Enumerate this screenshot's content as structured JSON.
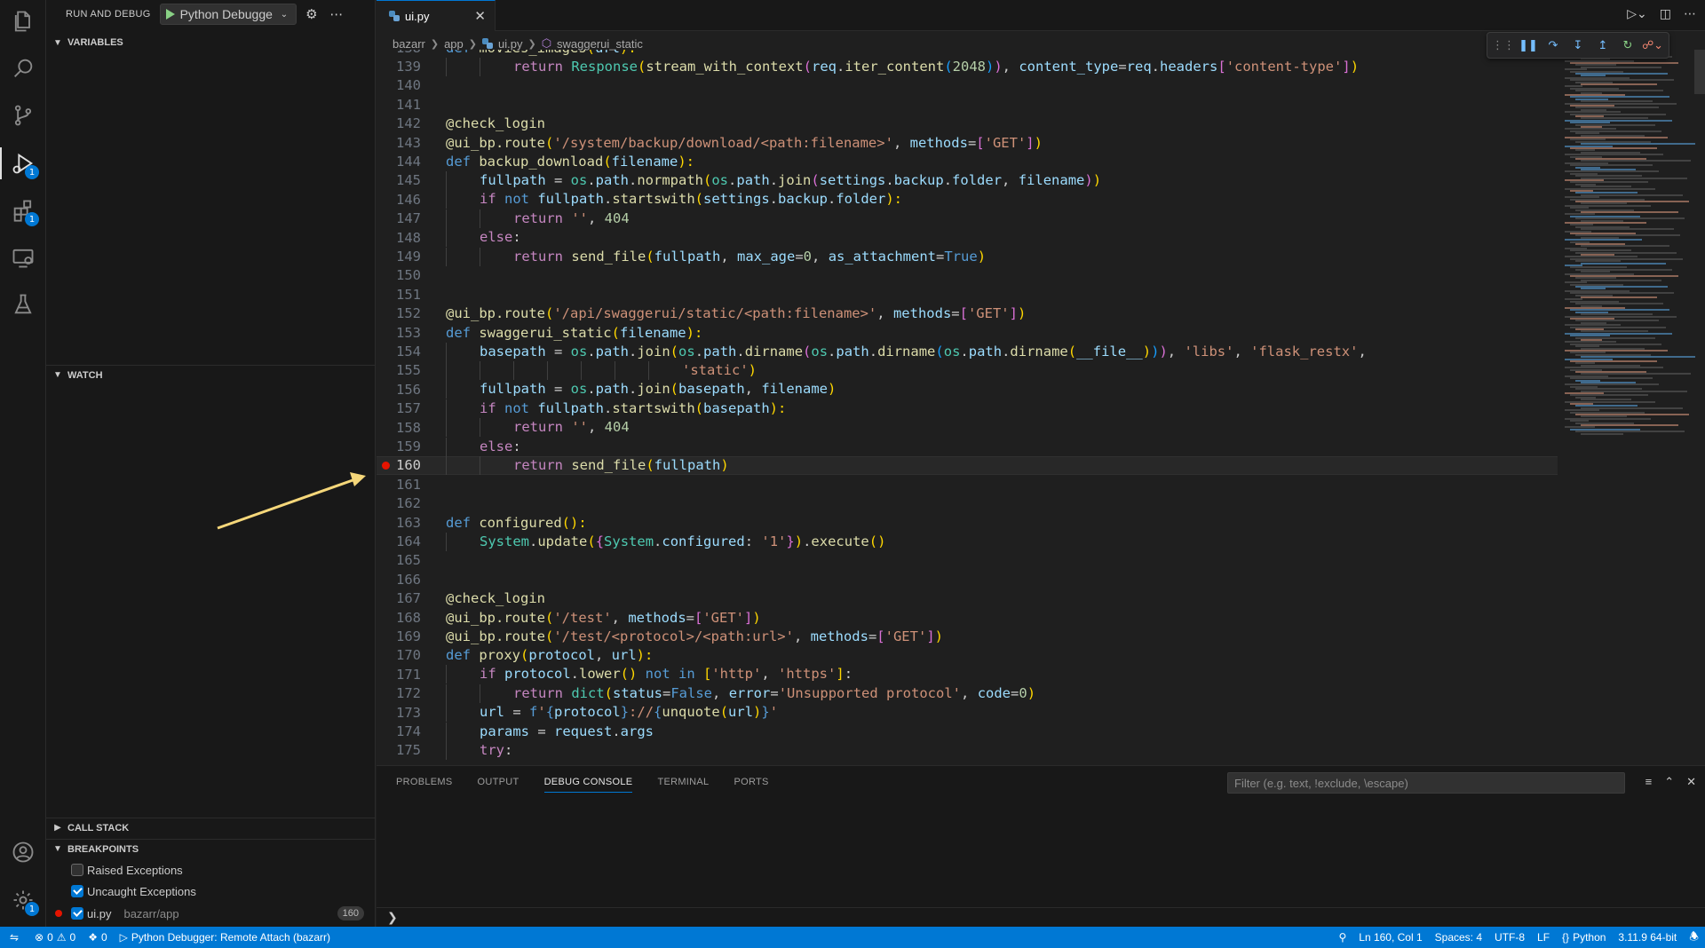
{
  "sidebar": {
    "title": "RUN AND DEBUG",
    "debug_config": "Python Debugge",
    "sections": {
      "variables": "VARIABLES",
      "watch": "WATCH",
      "call_stack": "CALL STACK",
      "breakpoints": "BREAKPOINTS"
    },
    "breakpoints": {
      "raised": "Raised Exceptions",
      "uncaught": "Uncaught Exceptions",
      "file": "ui.py",
      "path": "bazarr/app",
      "line": "160"
    }
  },
  "activity_bar": {
    "run_badge": "1",
    "extensions_badge": "1",
    "settings_badge": "1"
  },
  "editor": {
    "tab": "ui.py",
    "breadcrumb": [
      "bazarr",
      "app",
      "ui.py",
      "swaggerui_static"
    ],
    "current_line": "160"
  },
  "panel": {
    "tabs": [
      "PROBLEMS",
      "OUTPUT",
      "DEBUG CONSOLE",
      "TERMINAL",
      "PORTS"
    ],
    "filter_placeholder": "Filter (e.g. text, !exclude, \\escape)"
  },
  "statusbar": {
    "errors": "0",
    "warnings": "0",
    "ports": "0",
    "debug_target": "Python Debugger: Remote Attach (bazarr)",
    "cursor": "Ln 160, Col 1",
    "spaces": "Spaces: 4",
    "encoding": "UTF-8",
    "eol": "LF",
    "language": "Python",
    "interpreter": "3.11.9 64-bit"
  },
  "colors": {
    "accent": "#0078d4",
    "breakpoint": "#e51400",
    "arrow": "#f5d77a"
  }
}
